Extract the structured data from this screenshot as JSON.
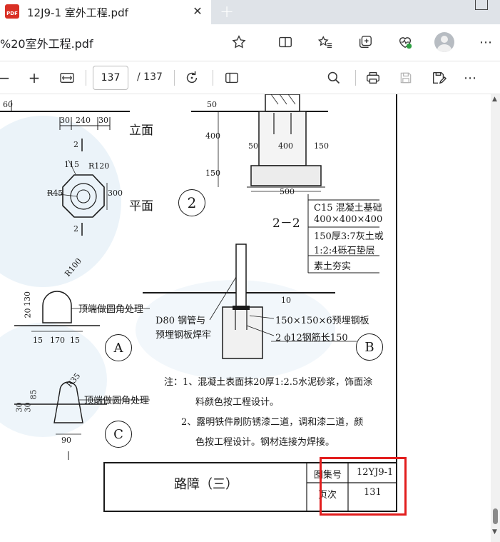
{
  "browser": {
    "tab": {
      "icon": "pdf-file-icon",
      "icon_label": "PDF",
      "title": "12J9-1 室外工程.pdf",
      "close": "✕"
    },
    "new_tab": "+",
    "url": "%20室外工程.pdf",
    "icons": [
      "star-icon",
      "split-screen-icon",
      "favorites-icon",
      "collections-icon",
      "health-icon",
      "profile-avatar",
      "more-icon"
    ],
    "more_label": "⋯"
  },
  "pdf_toolbar": {
    "zoom_out": "−",
    "zoom_in": "+",
    "current_page": "137",
    "total_pages": "/ 137",
    "icons": [
      "fit-width-icon",
      "rotate-icon",
      "page-view-icon",
      "search-icon",
      "print-icon",
      "save-icon",
      "save-as-icon",
      "more-icon"
    ],
    "more_label": "⋯"
  },
  "drawing": {
    "elevation": {
      "dim_left": "60",
      "dims": [
        "30",
        "240",
        "30"
      ],
      "label": "立面",
      "section_mark": "2"
    },
    "plan": {
      "r_small": "R45",
      "d115": "115",
      "r120": "R120",
      "d300": "300",
      "label": "平面",
      "section_mark": "2"
    },
    "section22": {
      "d50a": "50",
      "d400v": "400",
      "d150v": "150",
      "d50b": "50",
      "d400h": "400",
      "d150h": "150",
      "d500": "500",
      "label": "2－2",
      "circle_num": "2"
    },
    "legend": [
      "C15 混凝土基础",
      "400×400×400",
      "150厚3:7灰土或",
      "1:2:4砾石垫层",
      "素土夯实"
    ],
    "detailA": {
      "r100": "R100",
      "d130": "130",
      "d20": "20",
      "dims": [
        "15",
        "170",
        "15"
      ],
      "note": "顶端做圆角处理",
      "circle": "A"
    },
    "detailB": {
      "pipe_note_1": "D80 钢管与",
      "pipe_note_2": "预埋钢板焊牢",
      "d10": "10",
      "plate_note": "150×150×6预埋钢板",
      "bar_note": "2 ϕ12钢筋长150",
      "circle": "B"
    },
    "detailC": {
      "r35": "R35",
      "d85": "85",
      "d30a": "30",
      "d30b": "30",
      "d90": "90",
      "note": "顶端做圆角处理",
      "circle": "C"
    },
    "notes": [
      "注：1、混凝土表面抹20厚1:2.5水泥砂浆，饰面涂",
      "料颜色按工程设计。",
      "2、露明铁件刷防锈漆二道，调和漆二道，颜",
      "色按工程设计。钢材连接为焊接。"
    ],
    "title_block": {
      "title": "路障（三）",
      "atlas_label": "图集号",
      "atlas_value": "12YJ9-1",
      "page_label": "页次",
      "page_value": "131"
    }
  },
  "colors": {
    "highlight": "#e21d1d",
    "tab_strip": "#dfe3e8",
    "pdf_badge": "#d93025"
  }
}
